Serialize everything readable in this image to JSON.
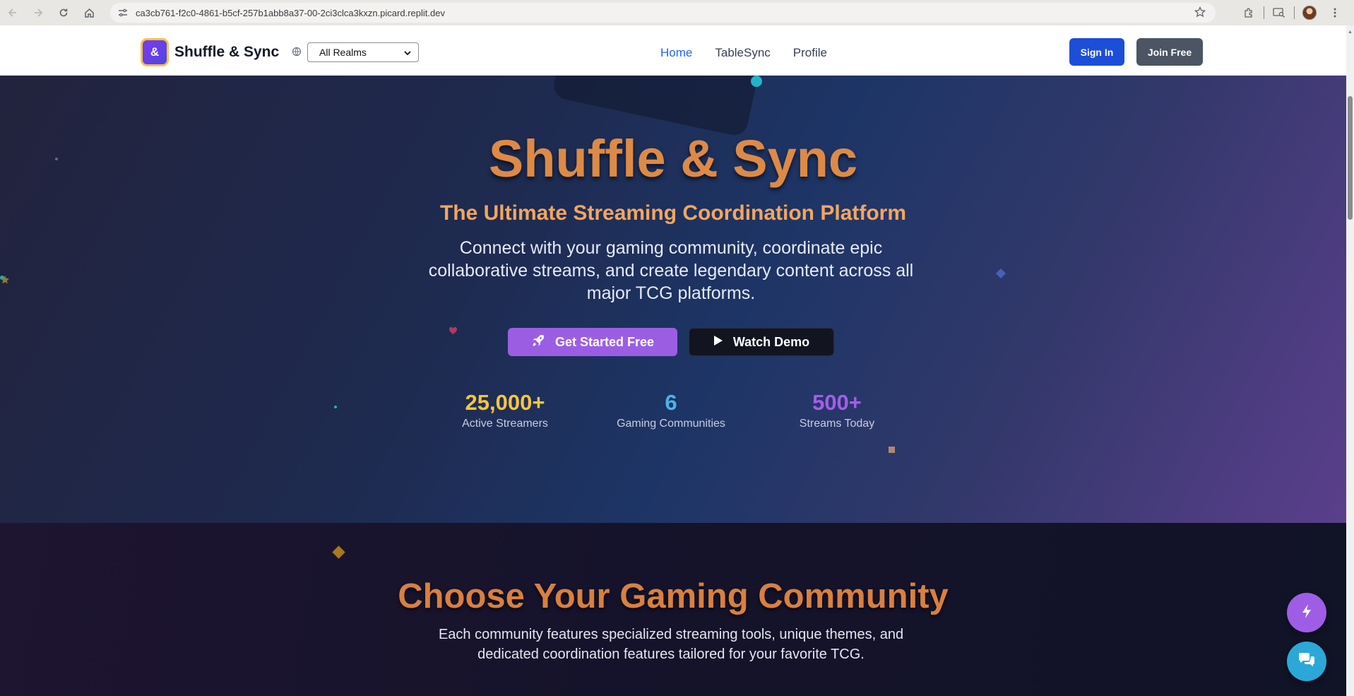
{
  "browser": {
    "url": "ca3cb761-f2c0-4861-b5cf-257b1abb8a37-00-2ci3clca3kxzn.picard.replit.dev"
  },
  "header": {
    "logo_glyph": "&",
    "brand": "Shuffle & Sync",
    "realm_select": {
      "selected": "All Realms"
    },
    "nav": [
      {
        "label": "Home",
        "active": true
      },
      {
        "label": "TableSync",
        "active": false
      },
      {
        "label": "Profile",
        "active": false
      }
    ],
    "sign_in_label": "Sign In",
    "join_label": "Join Free"
  },
  "hero": {
    "title": "Shuffle & Sync",
    "subtitle": "The Ultimate Streaming Coordination Platform",
    "description": "Connect with your gaming community, coordinate epic collaborative streams, and create legendary content across all major TCG platforms.",
    "cta_primary": "Get Started Free",
    "cta_secondary": "Watch Demo",
    "stats": [
      {
        "value": "25,000+",
        "label": "Active Streamers",
        "color": "#f5c542"
      },
      {
        "value": "6",
        "label": "Gaming Communities",
        "color": "#4fb3e8"
      },
      {
        "value": "500+",
        "label": "Streams Today",
        "color": "#a35ee8"
      }
    ]
  },
  "community": {
    "title": "Choose Your Gaming Community",
    "description": "Each community features specialized streaming tools, unique themes, and dedicated coordination features tailored for your favorite TCG."
  },
  "colors": {
    "accent_orange": "#dd8a46",
    "primary_purple": "#9b5ee3",
    "nav_active_blue": "#2563eb",
    "sign_in_blue": "#1d4ed8"
  }
}
